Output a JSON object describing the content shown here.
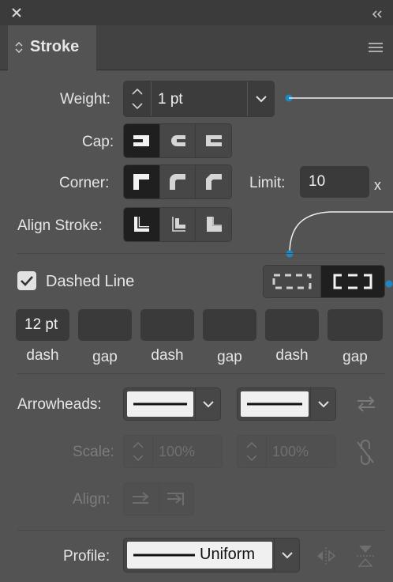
{
  "window": {
    "close_icon": "close-icon",
    "collapse_icon": "double-chevron-icon"
  },
  "panel": {
    "tab_label": "Stroke",
    "menu_icon": "hamburger-icon"
  },
  "weight": {
    "label": "Weight:",
    "value": "1 pt"
  },
  "cap": {
    "label": "Cap:",
    "options": [
      "butt-cap",
      "round-cap",
      "projecting-cap"
    ],
    "selected": 0
  },
  "corner": {
    "label": "Corner:",
    "options": [
      "miter-join",
      "round-join",
      "bevel-join"
    ],
    "selected": 0,
    "limit_label": "Limit:",
    "limit_value": "10",
    "limit_unit": "x"
  },
  "align_stroke": {
    "label": "Align Stroke:",
    "options": [
      "align-center",
      "align-inside",
      "align-outside"
    ],
    "selected": 0
  },
  "dashed": {
    "label": "Dashed Line",
    "checked": true,
    "modes": [
      "preserve-exact-dash",
      "align-dashes-to-corners"
    ],
    "selected_mode": 1
  },
  "dash_fields": [
    {
      "value": "12 pt",
      "label": "dash"
    },
    {
      "value": "",
      "label": "gap"
    },
    {
      "value": "",
      "label": "dash"
    },
    {
      "value": "",
      "label": "gap"
    },
    {
      "value": "",
      "label": "dash"
    },
    {
      "value": "",
      "label": "gap"
    }
  ],
  "arrowheads": {
    "label": "Arrowheads:"
  },
  "scale": {
    "label": "Scale:",
    "start": "100%",
    "end": "100%"
  },
  "align": {
    "label": "Align:"
  },
  "profile": {
    "label": "Profile:",
    "value": "Uniform"
  },
  "colors": {
    "panel": "#535353",
    "accent": "#1f87c6"
  }
}
